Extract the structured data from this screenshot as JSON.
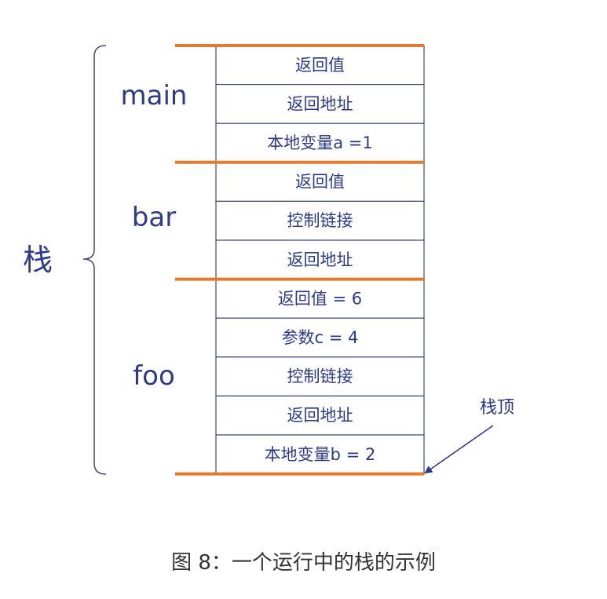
{
  "stack_label": "栈",
  "frames": [
    {
      "label": "main",
      "cells": [
        "返回值",
        "返回地址",
        "本地变量a =1"
      ]
    },
    {
      "label": "bar",
      "cells": [
        "返回值",
        "控制链接",
        "返回地址"
      ]
    },
    {
      "label": "foo",
      "cells": [
        "返回值 = 6",
        "参数c = 4",
        "控制链接",
        "返回地址",
        "本地变量b = 2"
      ]
    }
  ],
  "stack_top_label": "栈顶",
  "caption": "图 8：一个运行中的栈的示例",
  "colors": {
    "text": "#2d3a8c",
    "frame_divider": "#e8792c",
    "cell_border": "#3d4a7a",
    "bracket": "#3d4a7a",
    "caption": "#333333"
  }
}
